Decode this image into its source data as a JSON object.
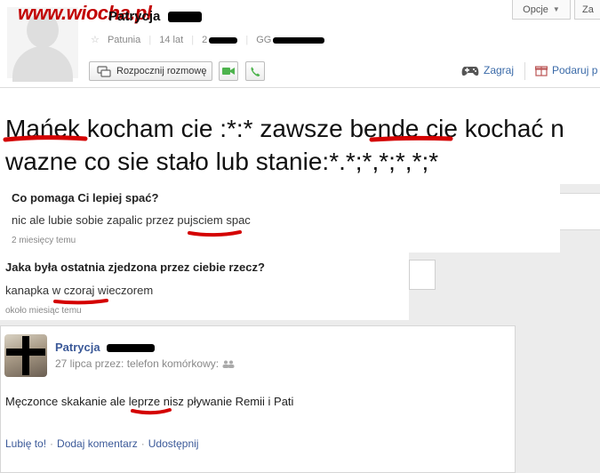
{
  "header": {
    "watermark": "www.wiocha.pl",
    "profile_name": "Patrycja",
    "meta": [
      "Patunia",
      "14 lat",
      "2",
      "GG"
    ],
    "buttons": {
      "start_chat": "Rozpocznij rozmowę",
      "options": "Opcje",
      "truncated": "Za"
    },
    "links": {
      "play": "Zagraj",
      "gift": "Podaruj p"
    }
  },
  "status": {
    "text": "Mańek kocham cie :*:* zawsze bende cie kochać n\nwazne co sie stało lub stanie:*.*;*,*;*,*;*"
  },
  "questions": [
    {
      "title": "Co pomaga Ci lepiej spać?",
      "answer": "nic ale lubie sobie zapalic przez pujsciem spac",
      "time": "2 miesięcy temu"
    },
    {
      "title": "Jaka była ostatnia zjedzona przez ciebie rzecz?",
      "answer": "kanapka w czoraj wieczorem",
      "time": "około miesiąc temu"
    }
  ],
  "post": {
    "author": "Patrycja",
    "meta": "27 lipca przez: telefon komórkowy:",
    "content": "Męczonce skakanie ale leprze nisz pływanie Remii i Pati",
    "actions": {
      "like": "Lubię to!",
      "comment": "Dodaj komentarz",
      "share": "Udostępnij",
      "separator": "·"
    }
  },
  "colors": {
    "link": "#3b5998",
    "marker": "#d40000",
    "watermark": "#c20000"
  }
}
